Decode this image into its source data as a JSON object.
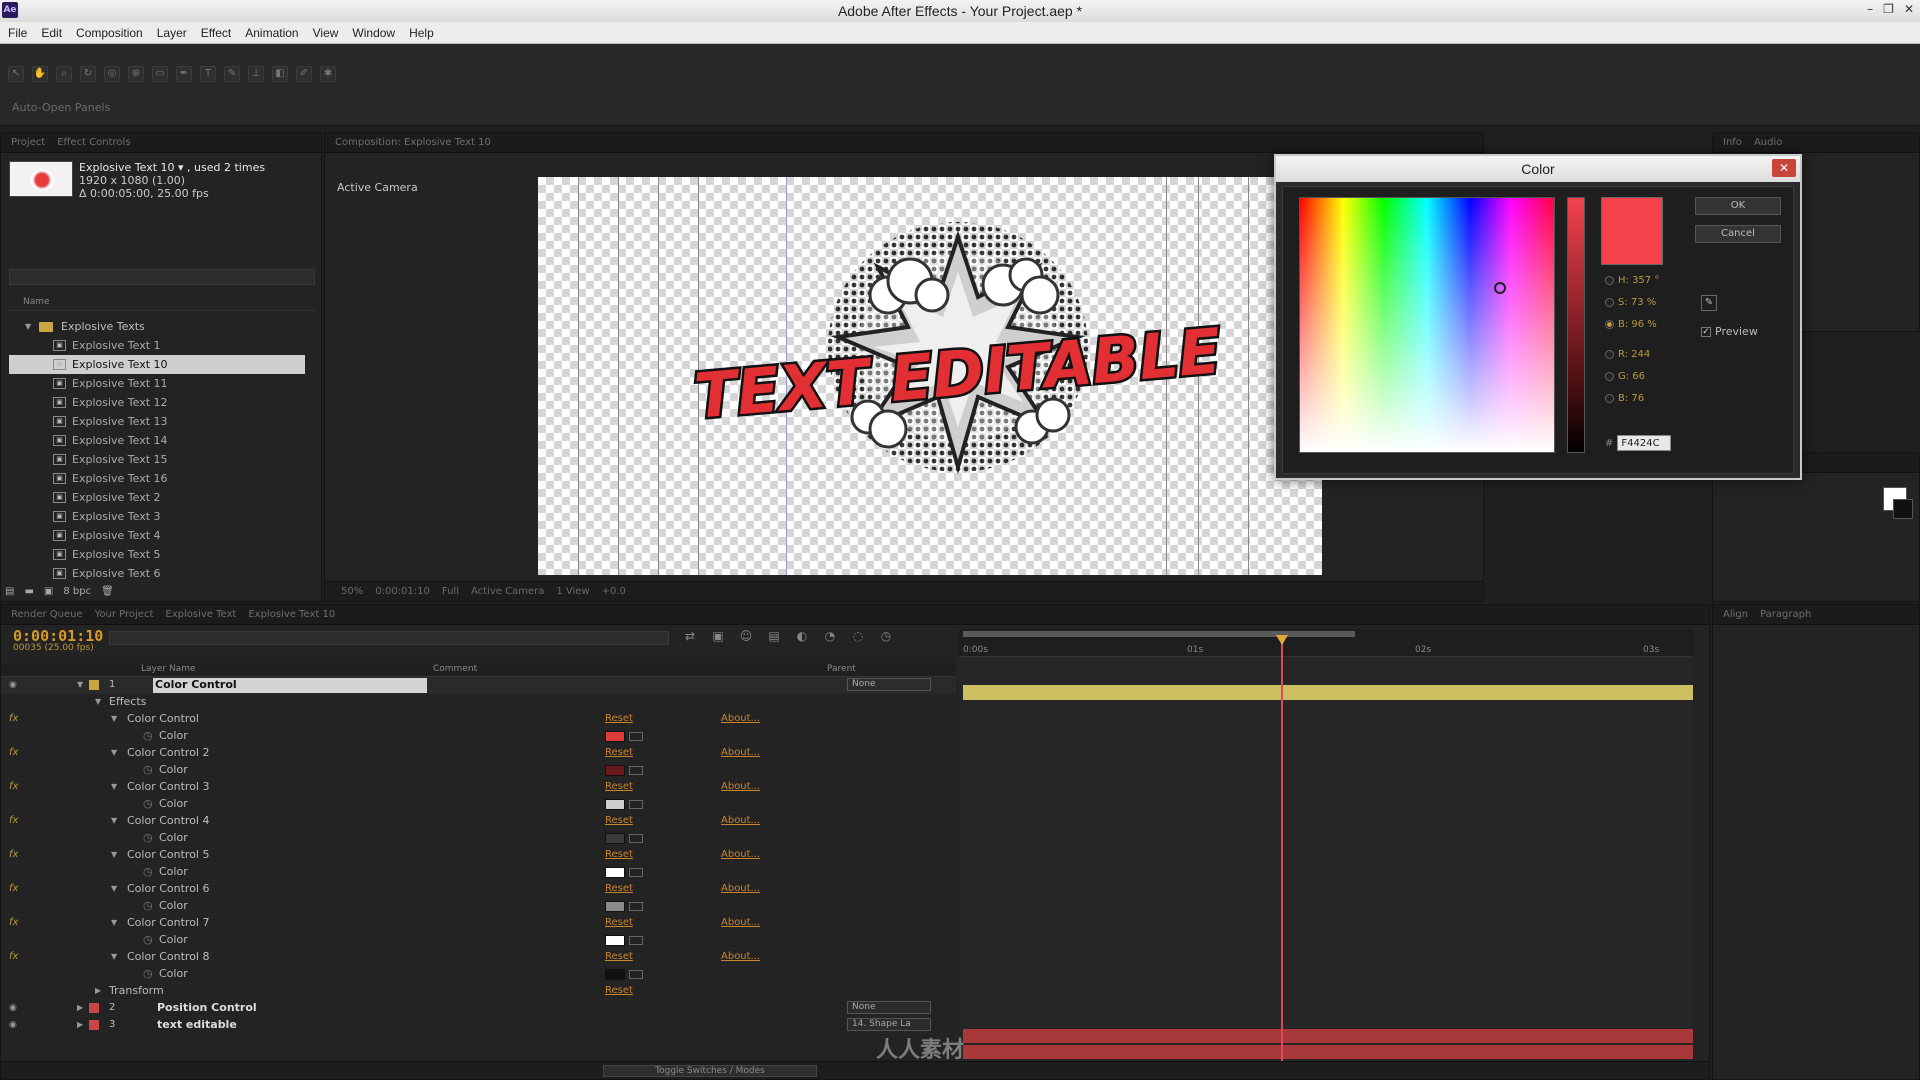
{
  "app": {
    "title": "Adobe After Effects - Your Project.aep *",
    "icon": "Ae",
    "window_buttons": [
      "–",
      "❐",
      "✕"
    ]
  },
  "menu": [
    "File",
    "Edit",
    "Composition",
    "Layer",
    "Effect",
    "Animation",
    "View",
    "Window",
    "Help"
  ],
  "toolbar": {
    "auto_open": "Auto-Open Panels"
  },
  "project": {
    "item_name": "Explosive Text 10 ▾ , used 2 times",
    "item_dims": "1920 x 1080 (1.00)",
    "item_duration": "Δ 0:00:05:00, 25.00 fps",
    "col_name": "Name",
    "folder": "Explosive Texts",
    "items": [
      {
        "label": "Explosive Text 1",
        "selected": false
      },
      {
        "label": "Explosive Text 10",
        "selected": true
      },
      {
        "label": "Explosive Text 11",
        "selected": false
      },
      {
        "label": "Explosive Text 12",
        "selected": false
      },
      {
        "label": "Explosive Text 13",
        "selected": false
      },
      {
        "label": "Explosive Text 14",
        "selected": false
      },
      {
        "label": "Explosive Text 15",
        "selected": false
      },
      {
        "label": "Explosive Text 16",
        "selected": false
      },
      {
        "label": "Explosive Text 2",
        "selected": false
      },
      {
        "label": "Explosive Text 3",
        "selected": false
      },
      {
        "label": "Explosive Text 4",
        "selected": false
      },
      {
        "label": "Explosive Text 5",
        "selected": false
      },
      {
        "label": "Explosive Text 6",
        "selected": false
      }
    ],
    "bpc": "8 bpc"
  },
  "composition": {
    "active_camera": "Active Camera",
    "artwork_text": "TEXT EDITABLE",
    "footer_camera": "Active Camera",
    "footer_views": "1 View"
  },
  "color_dialog": {
    "title": "Color",
    "close": "✕",
    "ok": "OK",
    "cancel": "Cancel",
    "h": "H: 357 °",
    "s": "S: 73 %",
    "b": "B: 96 %",
    "r": "R: 244",
    "g": "G: 66",
    "bl": "B: 76",
    "hex_prefix": "#",
    "hex": "F4424C",
    "preview": "Preview",
    "current_color": "#f4424c"
  },
  "timeline": {
    "timecode": "0:00:01:10",
    "fps_note": "00035 (25.00 fps)",
    "col_layer_name": "Layer Name",
    "col_comment": "Comment",
    "col_parent": "Parent",
    "layer1": {
      "num": "1",
      "name": "Color Control",
      "parent": "None"
    },
    "effects_label": "Effects",
    "controls": [
      {
        "name": "Color Control",
        "color": "#e23b3b"
      },
      {
        "name": "Color Control 2",
        "color": "#6a1a1d"
      },
      {
        "name": "Color Control 3",
        "color": "#cfcfcf"
      },
      {
        "name": "Color Control 4",
        "color": "#3a3a3a"
      },
      {
        "name": "Color Control 5",
        "color": "#ffffff"
      },
      {
        "name": "Color Control 6",
        "color": "#8a8a8a"
      },
      {
        "name": "Color Control 7",
        "color": "#ffffff"
      },
      {
        "name": "Color Control 8",
        "color": "#111111"
      }
    ],
    "color_label": "Color",
    "reset": "Reset",
    "about": "About...",
    "transform": "Transform",
    "layer2": {
      "num": "2",
      "name": "Position Control",
      "parent": "None"
    },
    "layer3": {
      "num": "3",
      "name": "text editable",
      "parent": "14. Shape La"
    },
    "ruler": [
      "0:00s",
      "01s",
      "02s",
      "03s"
    ],
    "toggle": "Toggle Switches / Modes"
  },
  "watermark": "人人素材"
}
